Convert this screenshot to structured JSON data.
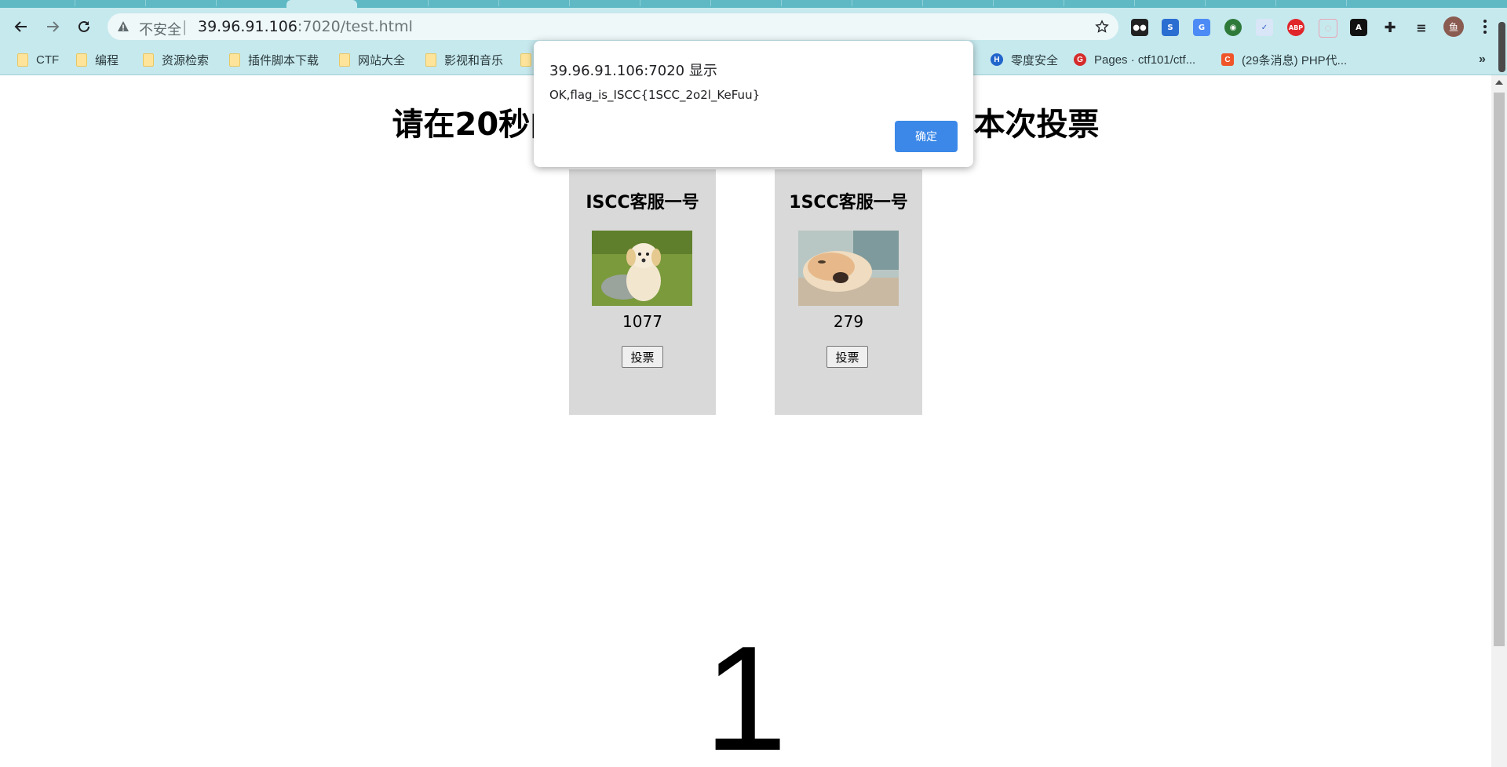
{
  "browser": {
    "url_host": "39.96.91.106",
    "url_rest": ":7020/test.html",
    "security_label": "不安全",
    "extensions": [
      "tampermonkey-icon",
      "s-extension-icon",
      "translate-icon",
      "green-ext-icon",
      "check-ext-icon",
      "abp-icon",
      "cat-ext-icon",
      "a-ext-icon",
      "puzzle-icon",
      "media-icon"
    ],
    "abp_label": "ABP",
    "profile_initial": "鱼"
  },
  "bookmarks": [
    {
      "label": "CTF",
      "type": "folder"
    },
    {
      "label": "编程",
      "type": "folder"
    },
    {
      "label": "资源检索",
      "type": "folder"
    },
    {
      "label": "插件脚本下载",
      "type": "folder"
    },
    {
      "label": "网站大全",
      "type": "folder"
    },
    {
      "label": "影视和音乐",
      "type": "folder"
    },
    {
      "label": "零度安全",
      "type": "site",
      "icon": "H"
    },
    {
      "label": "Pages · ctf101/ctf...",
      "type": "site",
      "icon": "G"
    },
    {
      "label": "(29条消息) PHP代...",
      "type": "site",
      "icon": "C"
    }
  ],
  "page": {
    "heading": "请在20秒内投出不少于1000票 ，以完成本次投票",
    "candidates": [
      {
        "name": "ISCC客服一号",
        "votes": "1077",
        "vote_label": "投票"
      },
      {
        "name": "1SCC客服一号",
        "votes": "279",
        "vote_label": "投票"
      }
    ],
    "timer": "1"
  },
  "dialog": {
    "title": "39.96.91.106:7020 显示",
    "message": "OK,flag_is_ISCC{1SCC_2o2l_KeFuu}",
    "ok_label": "确定"
  },
  "colors": {
    "chrome_bg": "#c6e9ee",
    "tab_strip": "#5eb9c4",
    "card_bg": "#d9d9d9",
    "dialog_button": "#3b88e8"
  }
}
